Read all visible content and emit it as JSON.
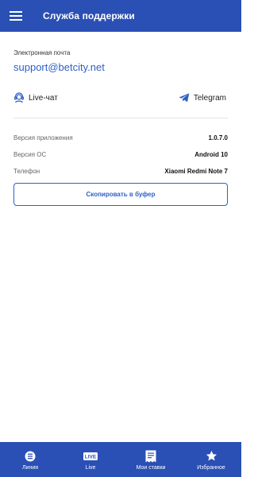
{
  "header": {
    "title": "Служба поддержки",
    "menu_icon": "hamburger-menu-icon"
  },
  "email": {
    "label": "Электронная почта",
    "value": "support@betcity.net"
  },
  "contacts": [
    {
      "label": "Live-чат",
      "icon": "headset-icon"
    },
    {
      "label": "Telegram",
      "icon": "telegram-icon"
    }
  ],
  "info": [
    {
      "key": "Версия приложения",
      "value": "1.0.7.0"
    },
    {
      "key": "Версия ОС",
      "value": "Android 10"
    },
    {
      "key": "Телефон",
      "value": "Xiaomi Redmi Note 7"
    }
  ],
  "copy_button": {
    "label": "Скопировать в буфер"
  },
  "bottom_nav": [
    {
      "label": "Линия",
      "icon": "line-icon"
    },
    {
      "label": "Live",
      "icon": "live-badge-icon",
      "badge_text": "LIVE"
    },
    {
      "label": "Мои ставки",
      "icon": "bet-slip-icon"
    },
    {
      "label": "Избранное",
      "icon": "star-icon"
    }
  ],
  "colors": {
    "primary": "#2a4fb5",
    "link": "#2f5fc9",
    "divider": "#e4e4e4"
  }
}
